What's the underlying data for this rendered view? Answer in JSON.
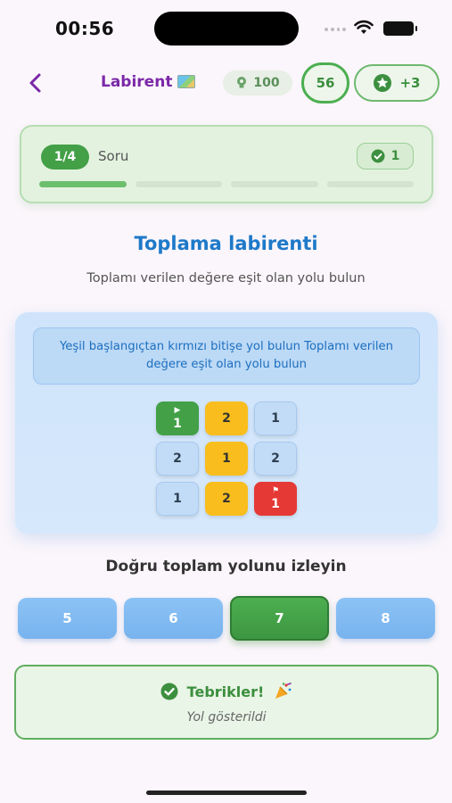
{
  "status_bar": {
    "time": "00:56"
  },
  "header": {
    "title": "Labirent",
    "coins": "100",
    "timer": "56",
    "stars": "+3"
  },
  "progress": {
    "question_badge": "1/4",
    "question_label": "Soru",
    "correct_count": "1",
    "segments_total": 4,
    "segments_done": 1
  },
  "main": {
    "title": "Toplama labirenti",
    "subtitle": "Toplamı verilen değere eşit olan yolu bulun",
    "instruction": "Yeşil başlangıçtan kırmızı bitişe yol bulun Toplamı verilen değere eşit olan yolu bulun",
    "grid": [
      [
        {
          "value": "1",
          "kind": "start"
        },
        {
          "value": "2",
          "kind": "path"
        },
        {
          "value": "1",
          "kind": "normal"
        }
      ],
      [
        {
          "value": "2",
          "kind": "normal"
        },
        {
          "value": "1",
          "kind": "path"
        },
        {
          "value": "2",
          "kind": "normal"
        }
      ],
      [
        {
          "value": "1",
          "kind": "normal"
        },
        {
          "value": "2",
          "kind": "path"
        },
        {
          "value": "1",
          "kind": "end"
        }
      ]
    ],
    "question": "Doğru toplam yolunu izleyin",
    "options": [
      "5",
      "6",
      "7",
      "8"
    ],
    "selected_option": "7"
  },
  "result": {
    "title": "Tebrikler!",
    "subtitle": "Yol gösterildi"
  },
  "colors": {
    "accent_purple": "#7a28a8",
    "accent_green": "#43a047",
    "accent_blue": "#1e79c9",
    "path_yellow": "#f9be1d",
    "end_red": "#e53935"
  }
}
